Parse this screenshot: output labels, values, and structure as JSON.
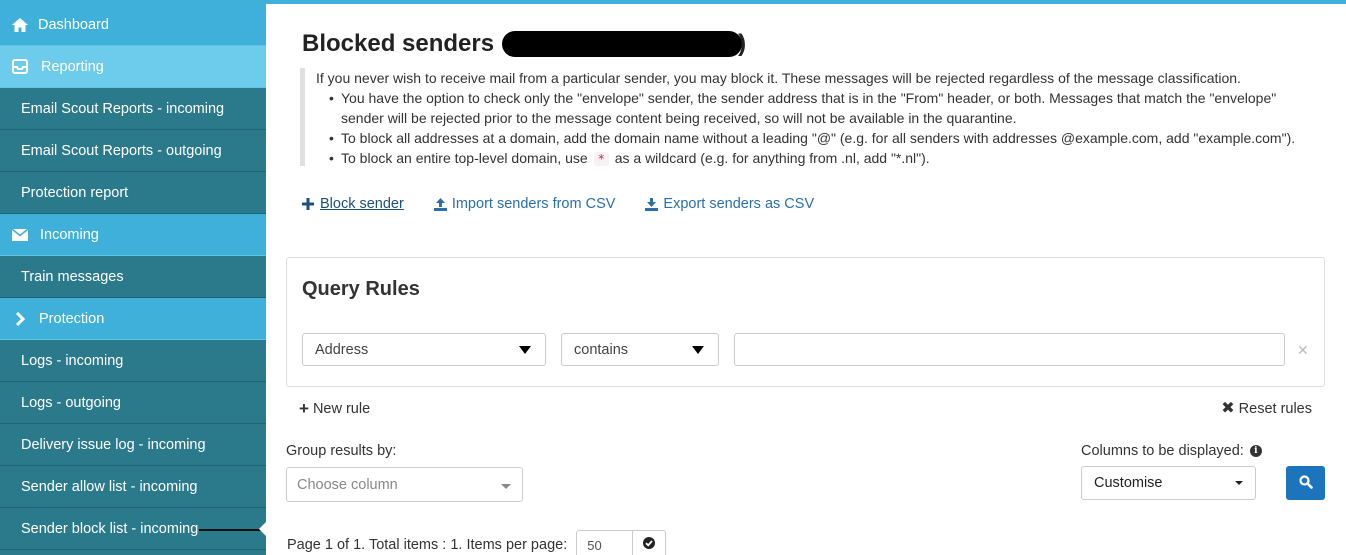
{
  "sidebar": {
    "items": [
      {
        "label": "Dashboard",
        "type": "section",
        "icon": "home-icon"
      },
      {
        "label": "Reporting",
        "type": "section",
        "icon": "inbox-icon",
        "active": true
      },
      {
        "label": "Email Scout Reports - incoming",
        "type": "sub"
      },
      {
        "label": "Email Scout Reports - outgoing",
        "type": "sub"
      },
      {
        "label": "Protection report",
        "type": "sub"
      },
      {
        "label": "Incoming",
        "type": "section",
        "icon": "envelope-icon"
      },
      {
        "label": "Train messages",
        "type": "sub"
      },
      {
        "label": "Protection",
        "type": "section",
        "icon": "chevron-right-icon"
      },
      {
        "label": "Logs - incoming",
        "type": "sub"
      },
      {
        "label": "Logs - outgoing",
        "type": "sub"
      },
      {
        "label": "Delivery issue log - incoming",
        "type": "sub"
      },
      {
        "label": "Sender allow list - incoming",
        "type": "sub"
      },
      {
        "label": "Sender block list - incoming",
        "type": "sub",
        "current": true
      }
    ]
  },
  "page": {
    "title": "Blocked senders",
    "title_close_paren": ")"
  },
  "info": {
    "intro": "If you never wish to receive mail from a particular sender, you may block it. These messages will be rejected regardless of the message classification.",
    "bullet1_line1": "You have the option to check only the \"envelope\" sender, the sender address that is in the \"From\" header, or both. Messages that match the \"envelope\"",
    "bullet1_line2": "sender will be rejected prior to the message content being received, so will not be available in the quarantine.",
    "bullet2": "To block all addresses at a domain, add the domain name without a leading \"@\" (e.g. for all senders with addresses @example.com, add \"example.com\").",
    "bullet3_pre": "To block an entire top-level domain, use",
    "bullet3_code": "*",
    "bullet3_post": "as a wildcard (e.g. for anything from .nl, add \"*.nl\")."
  },
  "actions": {
    "block_sender": "Block sender",
    "import_csv": "Import senders from CSV",
    "export_csv": "Export senders as CSV"
  },
  "query": {
    "title": "Query Rules",
    "field_select": "Address",
    "operator_select": "contains",
    "value": "",
    "new_rule": "New rule",
    "reset_rules": "Reset rules"
  },
  "grouping": {
    "label": "Group results by:",
    "placeholder": "Choose column"
  },
  "columns": {
    "label": "Columns to be displayed:",
    "selected": "Customise"
  },
  "pager": {
    "text": "Page 1 of 1. Total items : 1. Items per page:",
    "per_page": "50"
  },
  "colors": {
    "sidebar_bg": "#2b7a8c",
    "section_bg": "#3eb0d9",
    "active_section_bg": "#6dcbec",
    "link": "#2a6fad",
    "primary_button": "#1c75bc"
  }
}
